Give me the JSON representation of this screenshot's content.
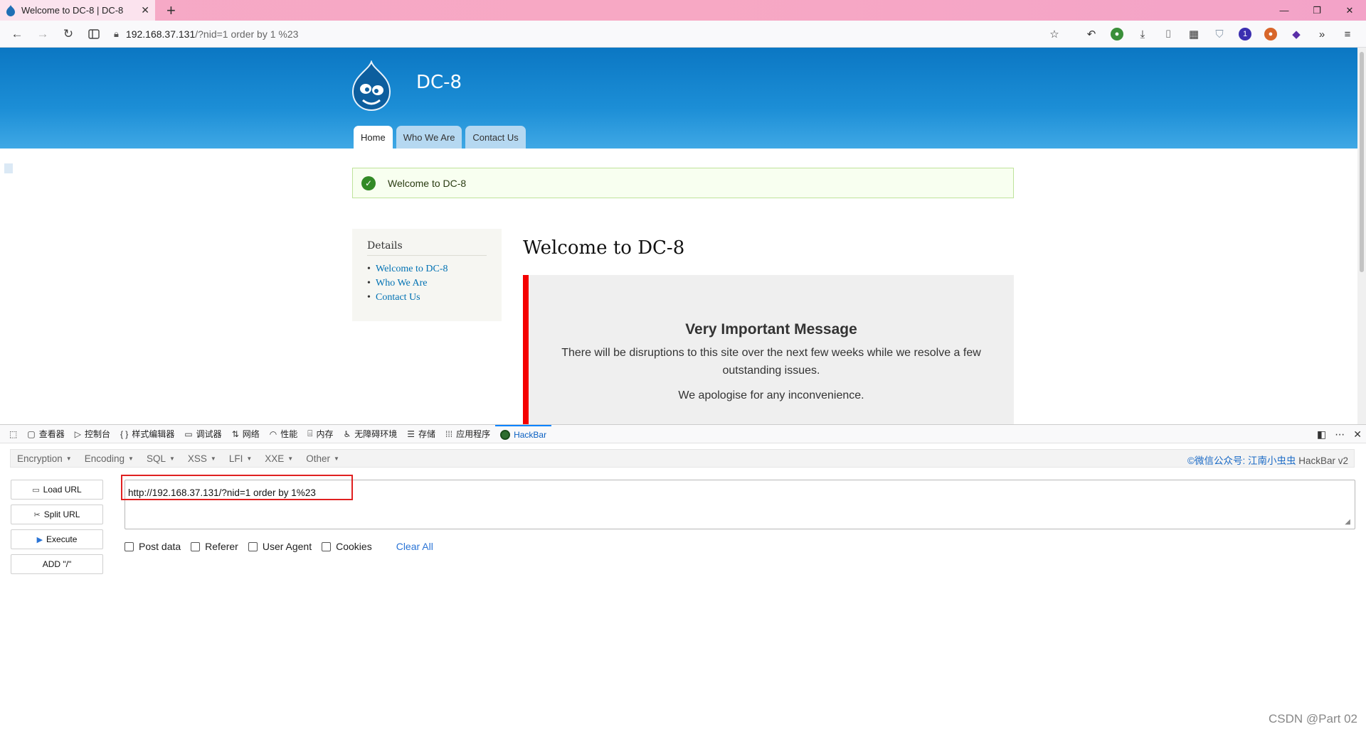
{
  "browser": {
    "tab_title": "Welcome to DC-8 | DC-8",
    "tab_close": "✕",
    "new_tab": "+",
    "window_controls": [
      "—",
      "❐",
      "✕"
    ],
    "url_host": "192.168.37.131",
    "url_path": "/?nid=1 order by 1 %23"
  },
  "site": {
    "name": "DC-8",
    "tabs": [
      "Home",
      "Who We Are",
      "Contact Us"
    ],
    "status_message": "Welcome to DC-8",
    "sidebar_title": "Details",
    "sidebar_links": [
      "Welcome to DC-8",
      "Who We Are",
      "Contact Us"
    ],
    "page_title": "Welcome to DC-8",
    "callout_title": "Very Important Message",
    "callout_p1": "There will be disruptions to this site over the next few weeks while we resolve a few outstanding issues.",
    "callout_p2": "We apologise for any inconvenience."
  },
  "devtools": {
    "tabs": [
      "查看器",
      "控制台",
      "样式编辑器",
      "调试器",
      "网络",
      "性能",
      "内存",
      "无障碍环境",
      "存储",
      "应用程序",
      "HackBar"
    ],
    "active_tab": "HackBar"
  },
  "hackbar": {
    "menus": [
      "Encryption",
      "Encoding",
      "SQL",
      "XSS",
      "LFI",
      "XXE",
      "Other"
    ],
    "credit_link": "©微信公众号: 江南小虫虫",
    "credit_name": "HackBar v2",
    "buttons": [
      "Load URL",
      "Split URL",
      "Execute",
      "ADD \"/\""
    ],
    "url_value": "http://192.168.37.131/?nid=1 order by 1%23",
    "options": [
      "Post data",
      "Referer",
      "User Agent",
      "Cookies"
    ],
    "clear_all": "Clear All"
  },
  "watermark": "CSDN @Part 02",
  "colors": {
    "header_blue": "#1c8ed6",
    "callout_border": "#f40000",
    "highlight_red": "#e02020",
    "link_blue": "#0071b3"
  }
}
